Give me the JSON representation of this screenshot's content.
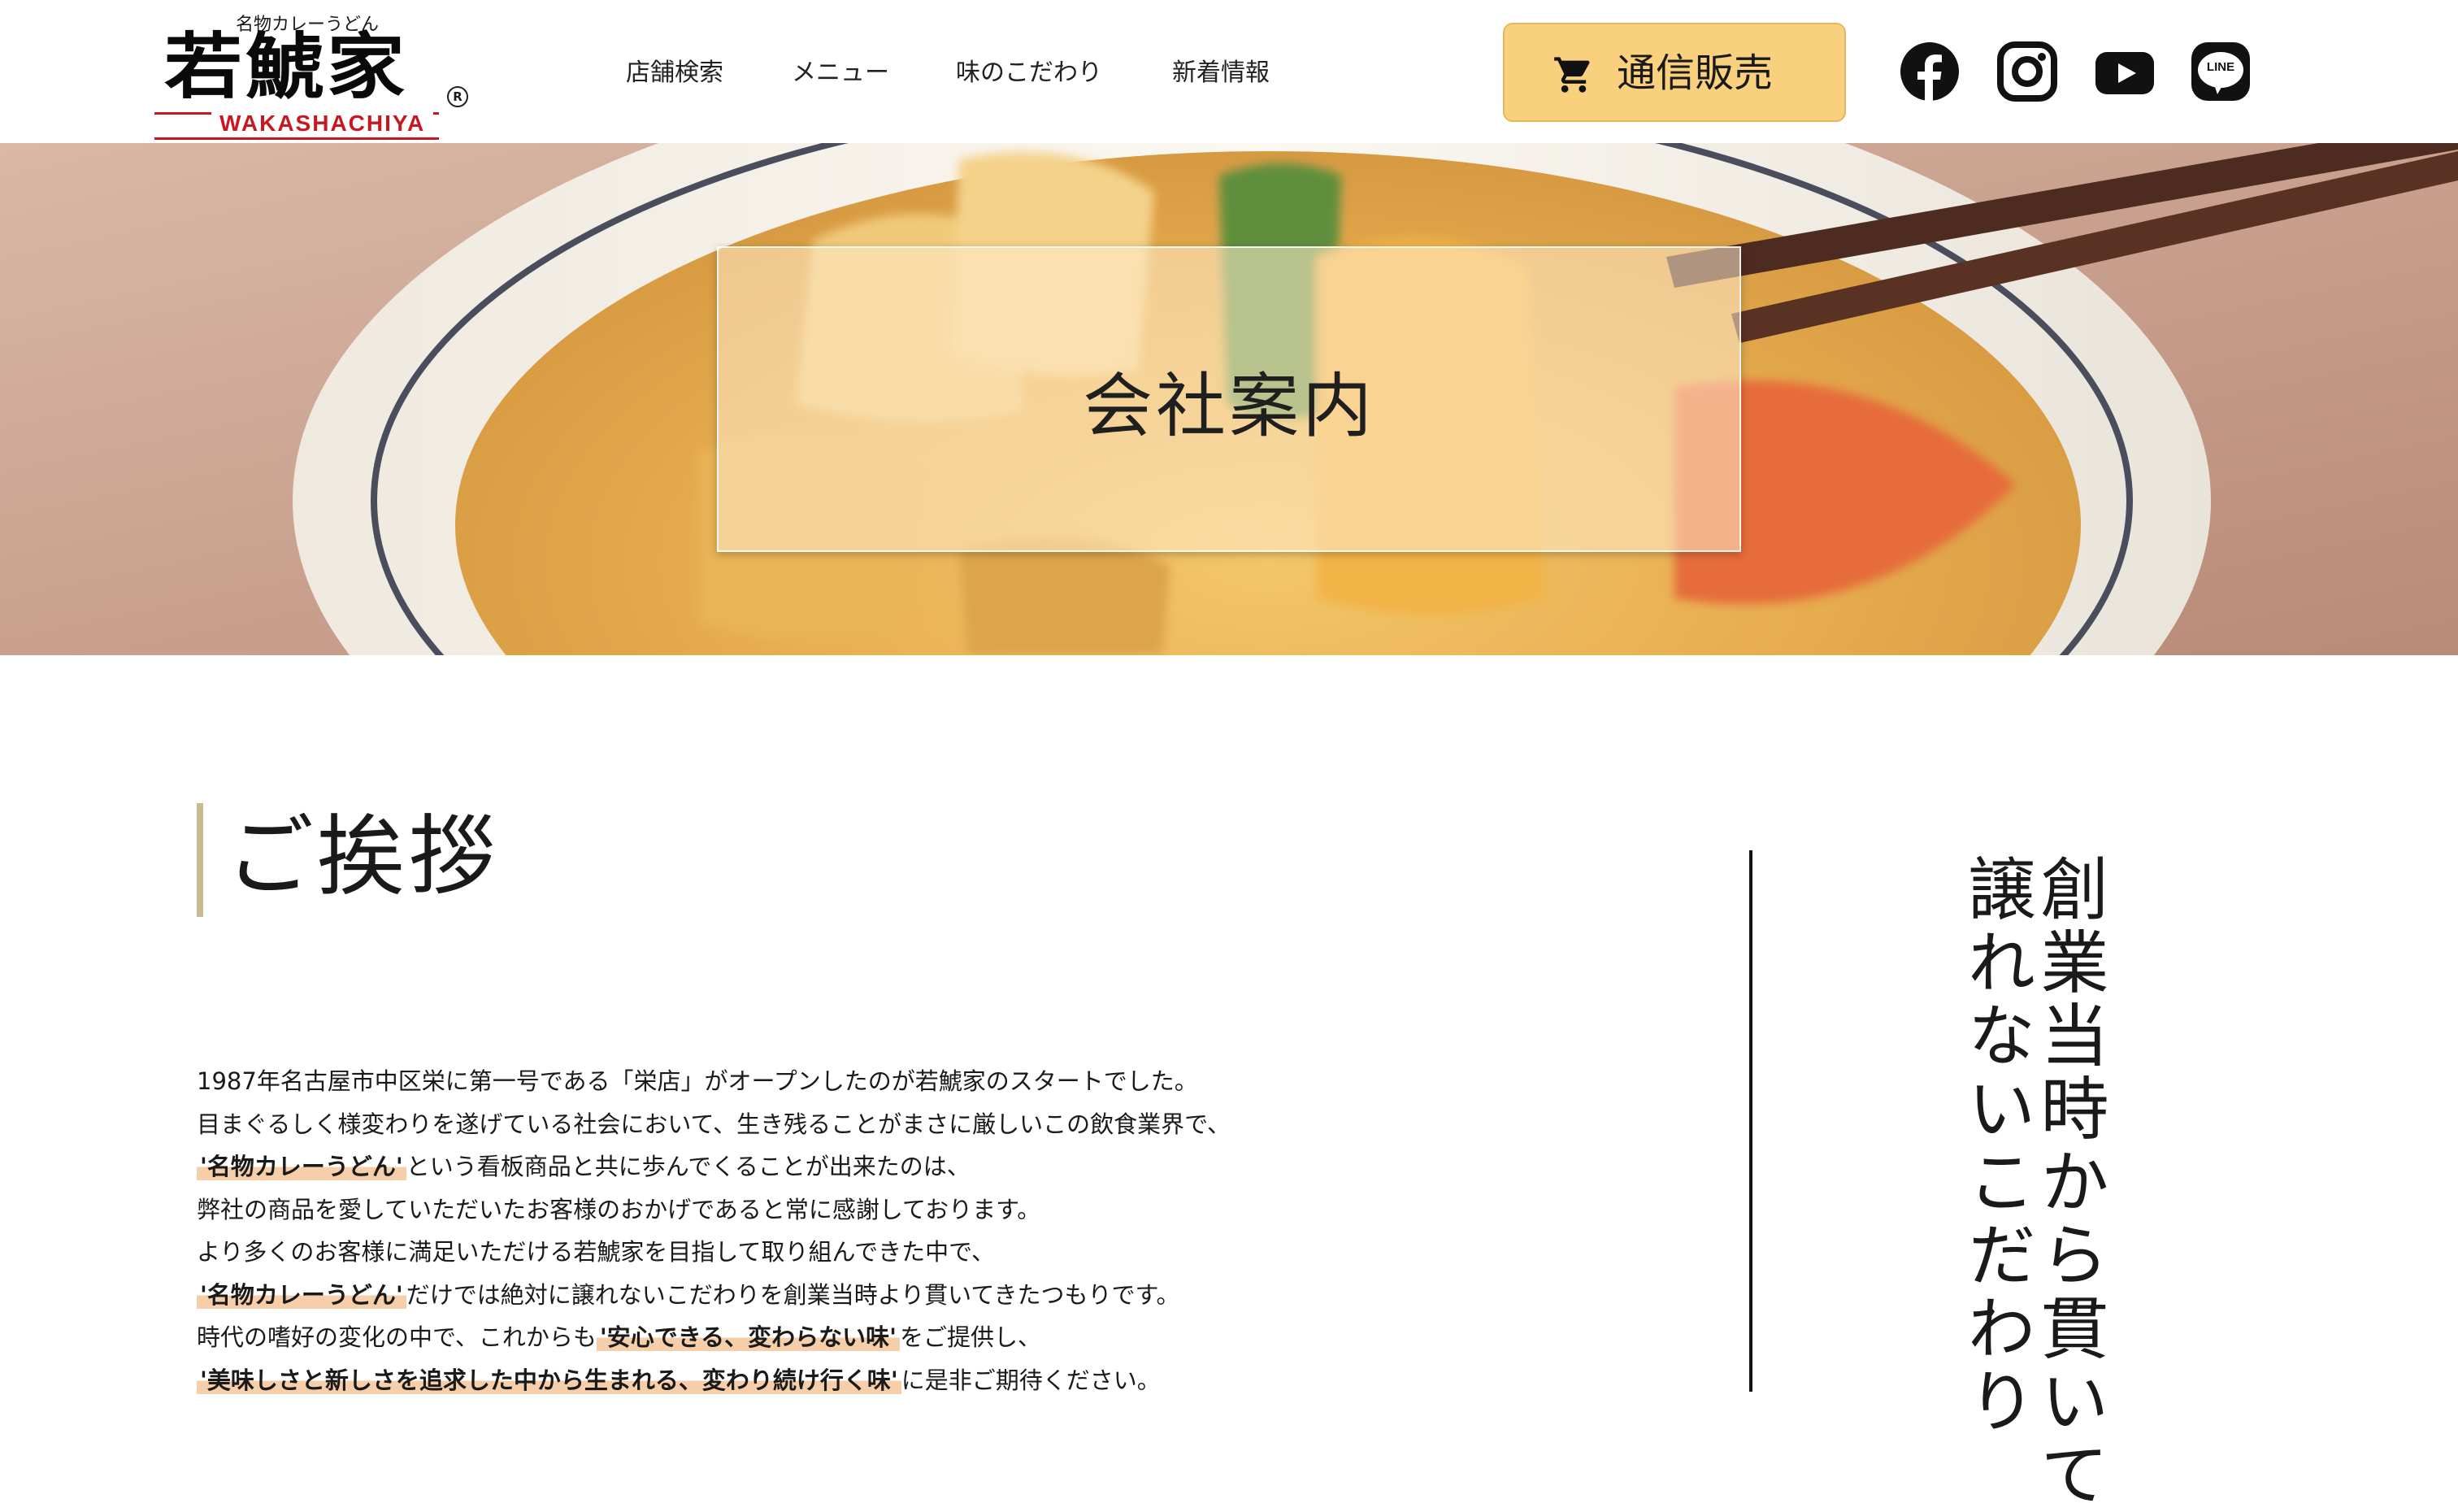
{
  "header": {
    "logo_tagline": "名物カレーうどん",
    "logo_name": "若鯱家",
    "logo_romaji": "WAKASHACHIYA",
    "logo_registered": "R",
    "nav": [
      {
        "label": "店舗検索"
      },
      {
        "label": "メニュー"
      },
      {
        "label": "味のこだわり"
      },
      {
        "label": "新着情報"
      }
    ],
    "shop_button": {
      "label": "通信販売",
      "icon": "cart-icon"
    },
    "social": [
      {
        "icon": "facebook-icon"
      },
      {
        "icon": "instagram-icon"
      },
      {
        "icon": "youtube-icon"
      },
      {
        "icon": "line-icon",
        "text": "LINE"
      }
    ]
  },
  "hero": {
    "title": "会社案内"
  },
  "greeting": {
    "title": "ご挨拶",
    "lines": [
      {
        "before": "1987年名古屋市中区栄に第一号である「栄店」がオープンしたのが若鯱家のスタートでした。"
      },
      {
        "before": "目まぐるしく様変わりを遂げている社会において、生き残ることがまさに厳しいこの飲食業界で、"
      },
      {
        "hl": "'名物カレーうどん'",
        "after": "という看板商品と共に歩んでくることが出来たのは、"
      },
      {
        "before": "弊社の商品を愛していただいたお客様のおかげであると常に感謝しております。"
      },
      {
        "before": "より多くのお客様に満足いただける若鯱家を目指して取り組んできた中で、"
      },
      {
        "hl": "'名物カレーうどん'",
        "after": "だけでは絶対に譲れないこだわりを創業当時より貫いてきたつもりです。"
      },
      {
        "before": "時代の嗜好の変化の中で、これからも",
        "hl": "'安心できる、変わらない味'",
        "after": "をご提供し、"
      },
      {
        "hl": "'美味しさと新しさを追求した中から生まれる、変わり続け行く味'",
        "after": "に是非ご期待ください。"
      }
    ],
    "vertical_lines": [
      "創業当時から貫いて",
      "譲れないこだわり"
    ]
  },
  "colors": {
    "accent": "#f8d07e",
    "highlight": "#f6cfaa",
    "logo_red": "#c8171e",
    "title_bar": "#c8b98f"
  }
}
